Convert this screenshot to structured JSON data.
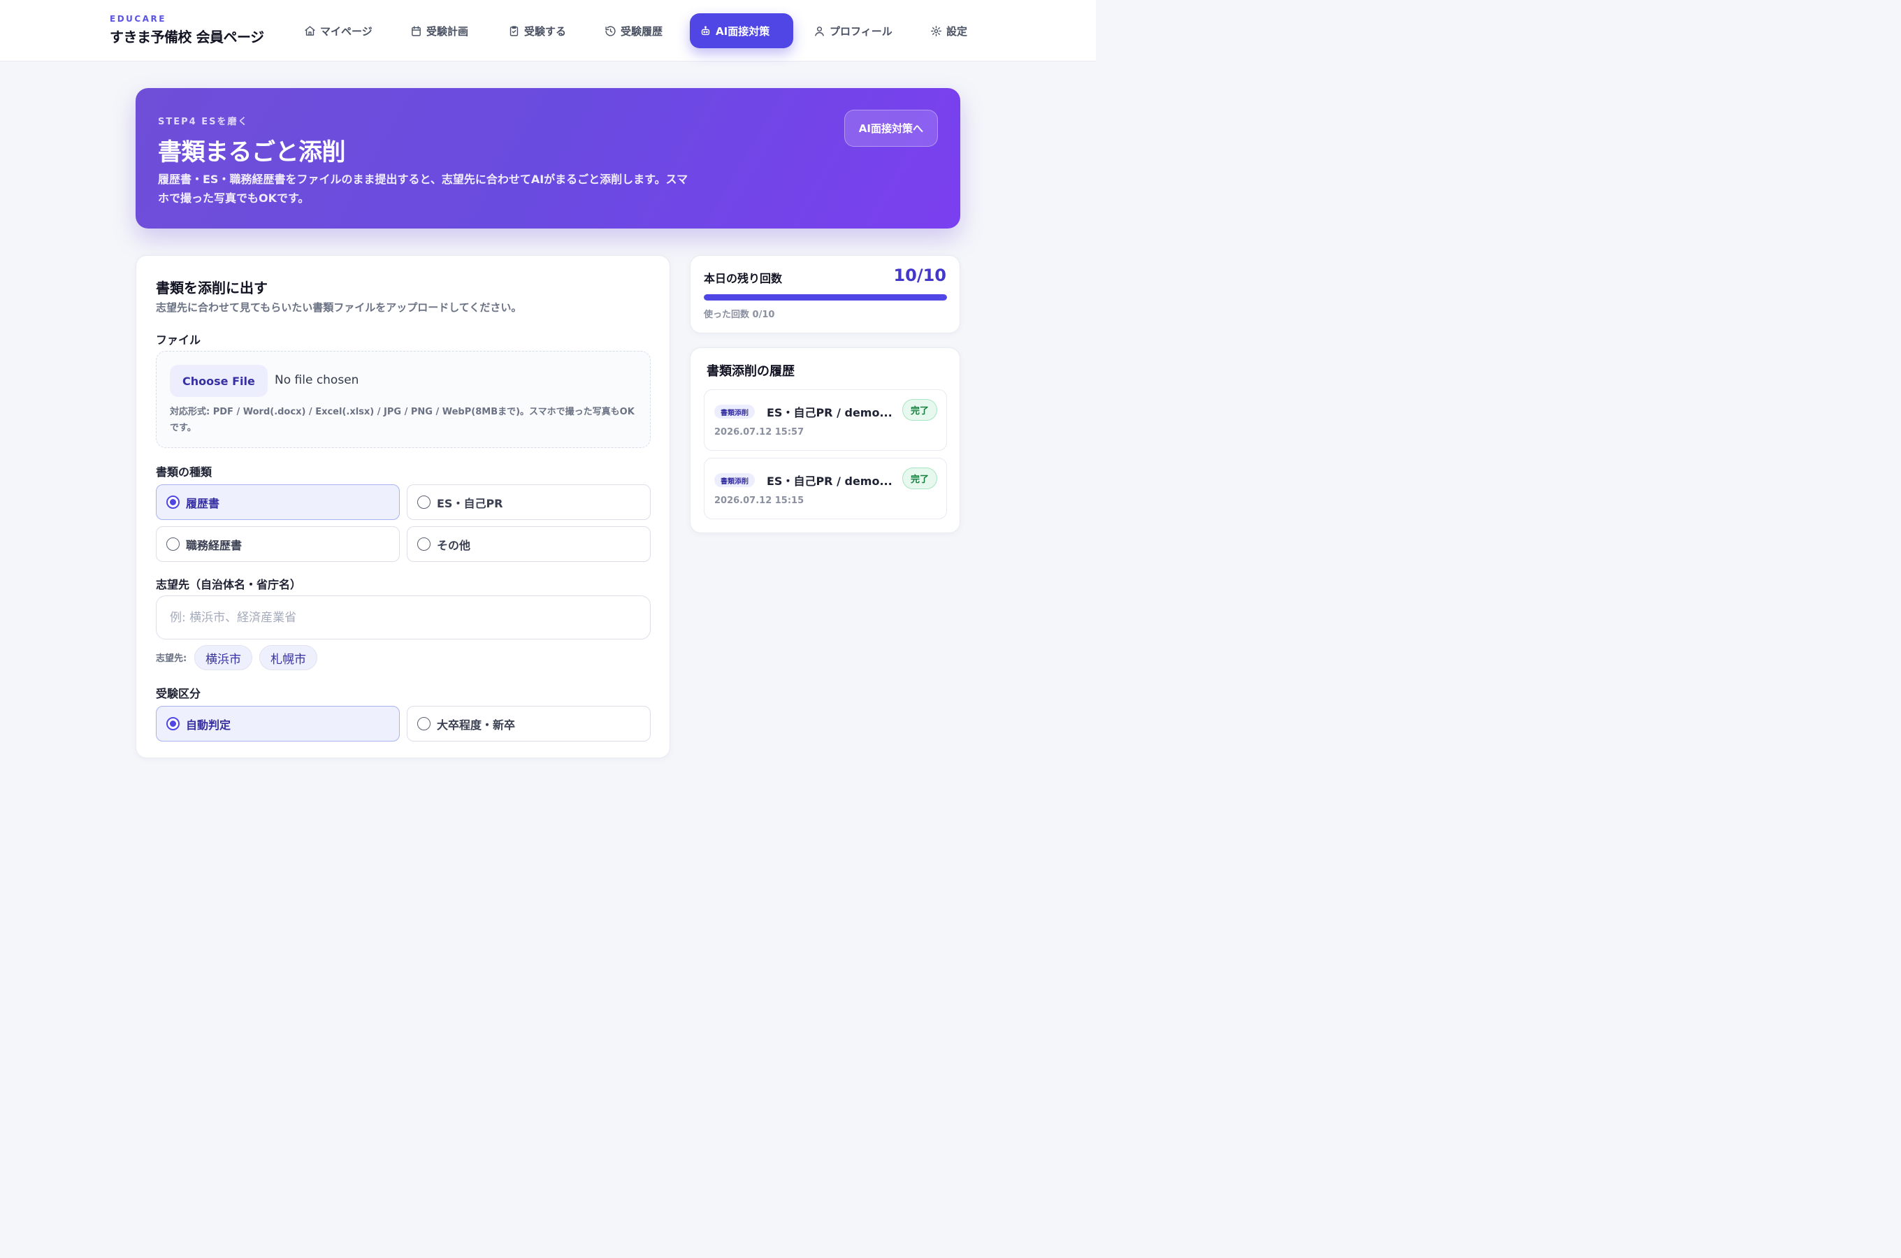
{
  "header": {
    "brand_small": "EDUCARE",
    "brand_title": "すきま予備校 会員ページ"
  },
  "nav": [
    {
      "label": "マイページ",
      "icon": "home-icon"
    },
    {
      "label": "受験計画",
      "icon": "calendar-icon"
    },
    {
      "label": "受験する",
      "icon": "clipboard-check-icon"
    },
    {
      "label": "受験履歴",
      "icon": "history-icon"
    },
    {
      "label": "AI面接対策",
      "icon": "robot-icon",
      "active": true
    },
    {
      "label": "プロフィール",
      "icon": "user-icon"
    },
    {
      "label": "設定",
      "icon": "gear-icon"
    }
  ],
  "hero": {
    "step": "STEP4 ESを磨く",
    "title": "書類まるごと添削",
    "description": "履歴書・ES・職務経歴書をファイルのまま提出すると、志望先に合わせてAIがまるごと添削します。スマホで撮った写真でもOKです。",
    "button": "AI面接対策へ"
  },
  "upload": {
    "title": "書類を添削に出す",
    "subtitle": "志望先に合わせて見てもらいたい書類ファイルをアップロードしてください。",
    "file_label": "ファイル",
    "file_button": "Choose File",
    "file_status": "No file chosen",
    "file_hint": "対応形式: PDF / Word(.docx) / Excel(.xlsx) / JPG / PNG / WebP(8MBまで)。スマホで撮った写真もOKです。",
    "doc_type_label": "書類の種類",
    "doc_types": [
      {
        "label": "履歴書",
        "selected": true
      },
      {
        "label": "ES・自己PR",
        "selected": false
      },
      {
        "label": "職務経歴書",
        "selected": false
      },
      {
        "label": "その他",
        "selected": false
      }
    ],
    "target_label": "志望先（自治体名・省庁名）",
    "target_placeholder": "例: 横浜市、経済産業省",
    "target_value": "",
    "chips_label": "志望先:",
    "chips": [
      "横浜市",
      "札幌市"
    ],
    "exam_label": "受験区分",
    "exam_types": [
      {
        "label": "自動判定",
        "selected": true
      },
      {
        "label": "大卒程度・新卒",
        "selected": false
      }
    ]
  },
  "quota": {
    "label": "本日の残り回数",
    "value": "10/10",
    "remaining_fraction": 1.0,
    "used_text": "使った回数 0/10"
  },
  "history": {
    "title": "書類添削の履歴",
    "items": [
      {
        "tag": "書類添削",
        "name": "ES・自己PR / demo...",
        "status": "完了",
        "date": "2026.07.12 15:57"
      },
      {
        "tag": "書類添削",
        "name": "ES・自己PR / demo...",
        "status": "完了",
        "date": "2026.07.12 15:15"
      }
    ]
  },
  "colors": {
    "accent": "#4f46e5",
    "hero_gradient_start": "#6f4fd8",
    "hero_gradient_end": "#7b3ff0",
    "status_done": "#15803d"
  }
}
